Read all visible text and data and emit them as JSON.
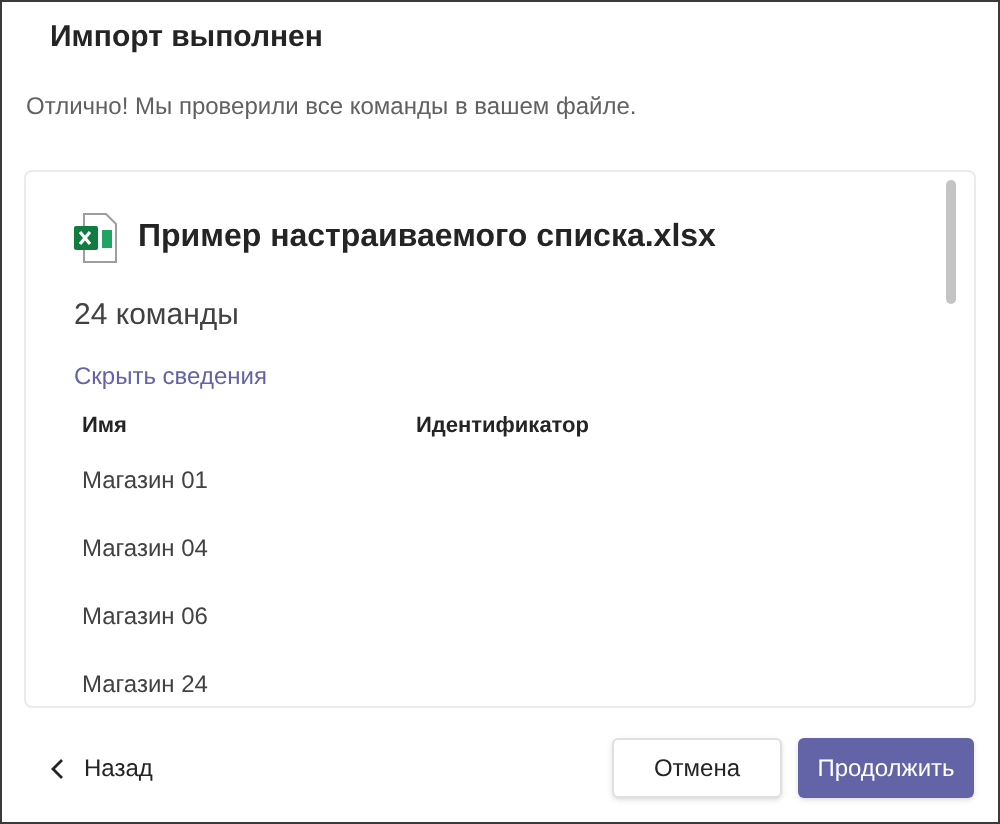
{
  "dialog": {
    "title": "Импорт выполнен",
    "message": "Отлично! Мы проверили все команды в вашем файле."
  },
  "file": {
    "name": "Пример настраиваемого списка.xlsx",
    "count": "24 команды",
    "toggle_link": "Скрыть сведения"
  },
  "table": {
    "columns": [
      "Имя",
      "Идентификатор"
    ],
    "rows": [
      {
        "name": "Магазин 01"
      },
      {
        "name": "Магазин 04"
      },
      {
        "name": "Магазин 06"
      },
      {
        "name": "Магазин 24"
      }
    ]
  },
  "footer": {
    "back": "Назад",
    "buttons": [
      {
        "label": "Отмена",
        "kind": "secondary"
      },
      {
        "label": "Продолжить",
        "kind": "primary"
      }
    ]
  }
}
